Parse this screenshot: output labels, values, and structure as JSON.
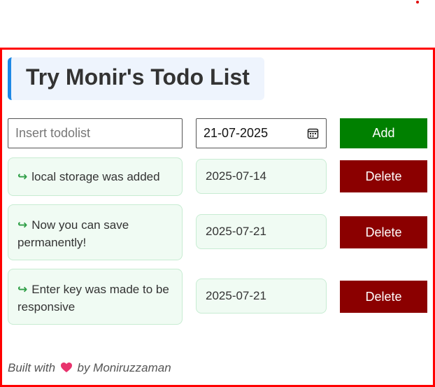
{
  "header": {
    "title": "Try Monir's Todo List"
  },
  "form": {
    "todo_placeholder": "Insert todolist",
    "date_value": "21-07-2025",
    "add_label": "Add"
  },
  "todos": [
    {
      "text": "local storage was added",
      "date": "2025-07-14",
      "delete_label": "Delete"
    },
    {
      "text": "Now you can save permanently!",
      "date": "2025-07-21",
      "delete_label": "Delete"
    },
    {
      "text": "Enter key was made to be responsive",
      "date": "2025-07-21",
      "delete_label": "Delete"
    }
  ],
  "footer": {
    "prefix": "Built with",
    "suffix": "by Moniruzzaman"
  },
  "icons": {
    "arrow": "curved-arrow-icon",
    "calendar": "calendar-icon",
    "heart": "heart-icon"
  },
  "colors": {
    "add": "#008000",
    "delete": "#8b0000",
    "frame": "#ff0000",
    "accent": "#1e88e5"
  }
}
